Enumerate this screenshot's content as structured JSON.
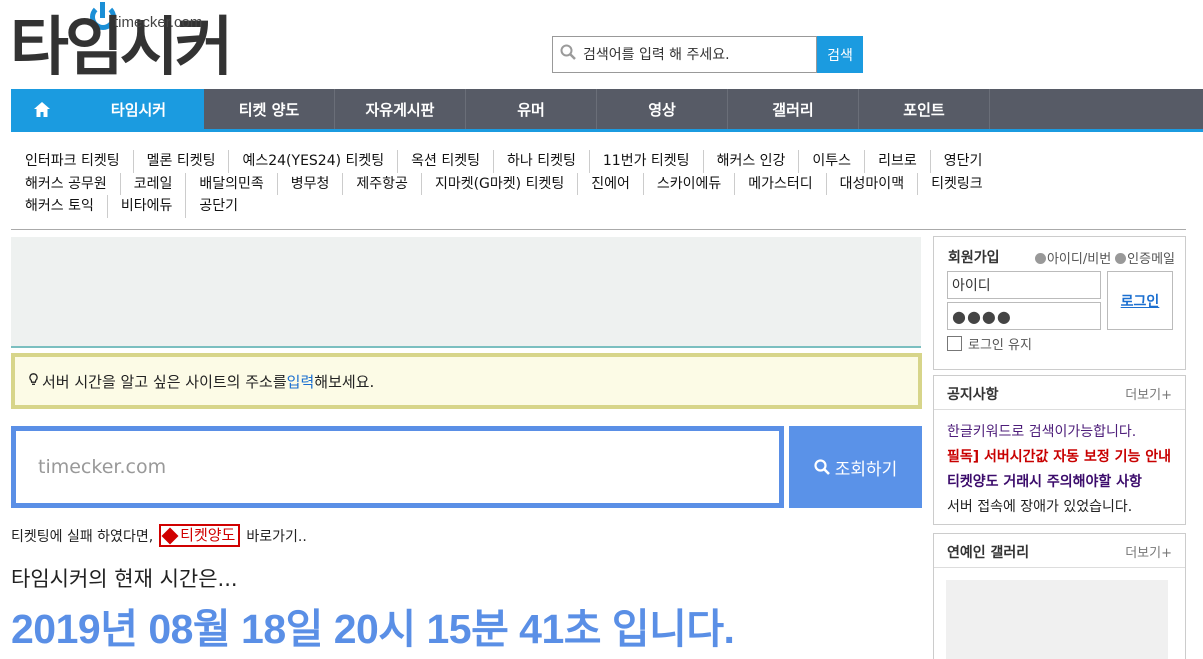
{
  "header": {
    "logo_text": "타임시커",
    "logo_domain": "timecker.com",
    "search_placeholder": "검색어를 입력 해 주세요.",
    "search_button": "검색"
  },
  "nav": {
    "items": [
      {
        "label": "타임시커",
        "active": true
      },
      {
        "label": "티켓 양도"
      },
      {
        "label": "자유게시판"
      },
      {
        "label": "유머"
      },
      {
        "label": "영상"
      },
      {
        "label": "갤러리"
      },
      {
        "label": "포인트"
      }
    ]
  },
  "links": {
    "row1": [
      "인터파크 티켓팅",
      "멜론 티켓팅",
      "예스24(YES24) 티켓팅",
      "옥션 티켓팅",
      "하나 티켓팅",
      "11번가 티켓팅",
      "해커스 인강",
      "이투스",
      "리브로",
      "영단기"
    ],
    "row2": [
      "해커스 공무원",
      "코레일",
      "배달의민족",
      "병무청",
      "제주항공",
      "지마켓(G마켓) 티켓팅",
      "진에어",
      "스카이에듀",
      "메가스터디",
      "대성마이맥",
      "티켓링크"
    ],
    "row3": [
      "해커스 토익",
      "비타에듀",
      "공단기"
    ]
  },
  "notice_bar": {
    "before": "서버 시간을 알고 싶은 사이트의 주소를 ",
    "highlight": "입력",
    "after": "해보세요."
  },
  "query": {
    "placeholder": "timecker.com",
    "button": "조회하기"
  },
  "fail_line": {
    "before": "티켓팅에 실패 하였다면,",
    "link": "티켓양도",
    "after": "바로가기.."
  },
  "now": {
    "label": "타임시커의 현재 시간은...",
    "time": "2019년 08월 18일 20시 15분 41초 입니다."
  },
  "login": {
    "title": "회원가입",
    "find_id": "아이디/비번",
    "auth_mail": "인증메일",
    "id_value": "아이디",
    "pw_value": "●●●●",
    "button": "로그인",
    "keep": "로그인 유지"
  },
  "notices": {
    "title": "공지사항",
    "more": "더보기+",
    "items": [
      "한글키워드로 검색이가능합니다.",
      "필독] 서버시간값 자동 보정 기능 안내",
      "티켓양도 거래시 주의해야할 사항",
      "서버 접속에 장애가 있었습니다."
    ]
  },
  "gallery": {
    "title": "연예인 갤러리",
    "more": "더보기+"
  },
  "colors": {
    "accent": "#1b9be0",
    "nav_bg": "#575b66",
    "query_blue": "#5a8fe6",
    "notice_border": "#d7d58a"
  }
}
